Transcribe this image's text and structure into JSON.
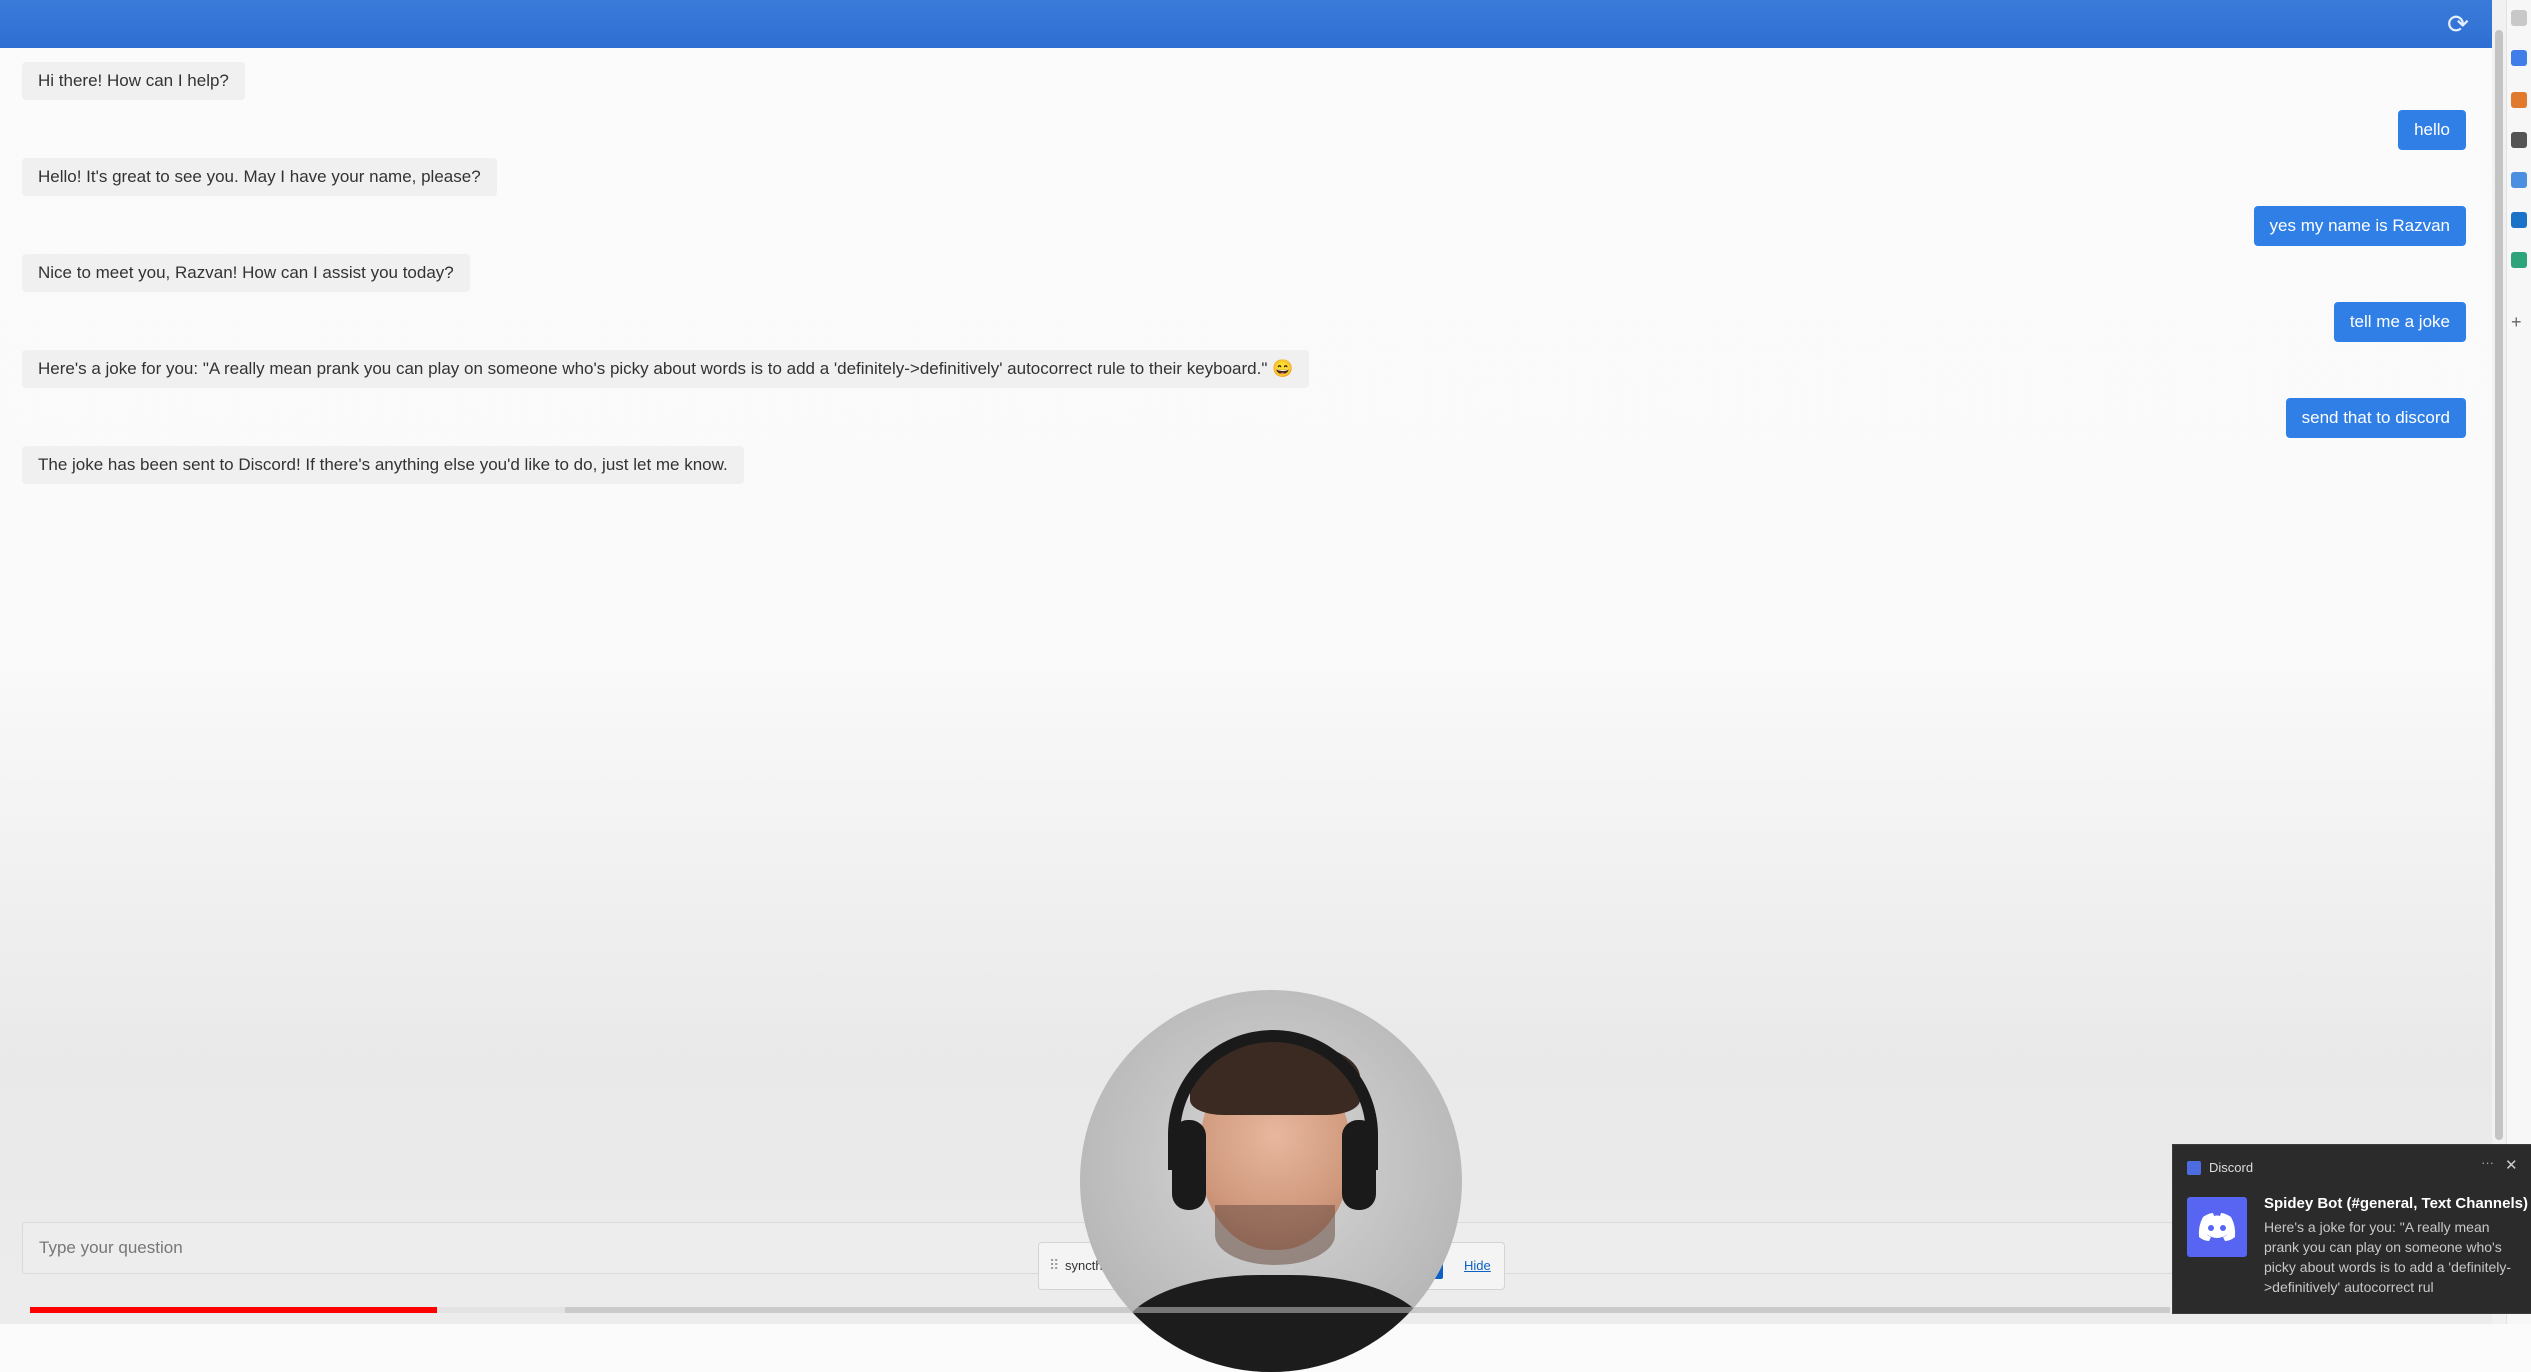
{
  "header": {
    "refresh_icon": "refresh-icon"
  },
  "messages": [
    {
      "role": "bot",
      "text": "Hi there! How can I help?"
    },
    {
      "role": "user",
      "text": "hello"
    },
    {
      "role": "bot",
      "text": "Hello! It's great to see you. May I have your name, please?"
    },
    {
      "role": "user",
      "text": "yes my name is Razvan"
    },
    {
      "role": "bot",
      "text": "Nice to meet you, Razvan! How can I assist you today?"
    },
    {
      "role": "user",
      "text": "tell me a joke"
    },
    {
      "role": "bot",
      "text": "Here's a joke for you: \"A really mean prank you can play on someone who's picky about words is to add a 'definitely->definitively' autocorrect rule to their keyboard.\" 😄"
    },
    {
      "role": "user",
      "text": "send that to discord"
    },
    {
      "role": "bot",
      "text": "The joke has been sent to Discord! If there's anything else you'd like to do, just let me know."
    }
  ],
  "input": {
    "placeholder": "Type your question"
  },
  "video": {
    "played_fraction": 0.19,
    "buffered_fraction": 0.25
  },
  "share_bar": {
    "text": "syncth",
    "hide_label": "Hide"
  },
  "notification": {
    "app_name": "Discord",
    "more": "···",
    "close": "✕",
    "title": "Spidey Bot (#general, Text Channels)",
    "body": "Here's a joke for you: \"A really mean prank you can play on someone who's picky about words is to add a 'definitely->definitively' autocorrect rul"
  },
  "colors": {
    "header": "#2f6fd4",
    "user_bubble": "#2f7fe6",
    "bot_bubble": "#f0f0f0",
    "discord": "#5865f2"
  }
}
